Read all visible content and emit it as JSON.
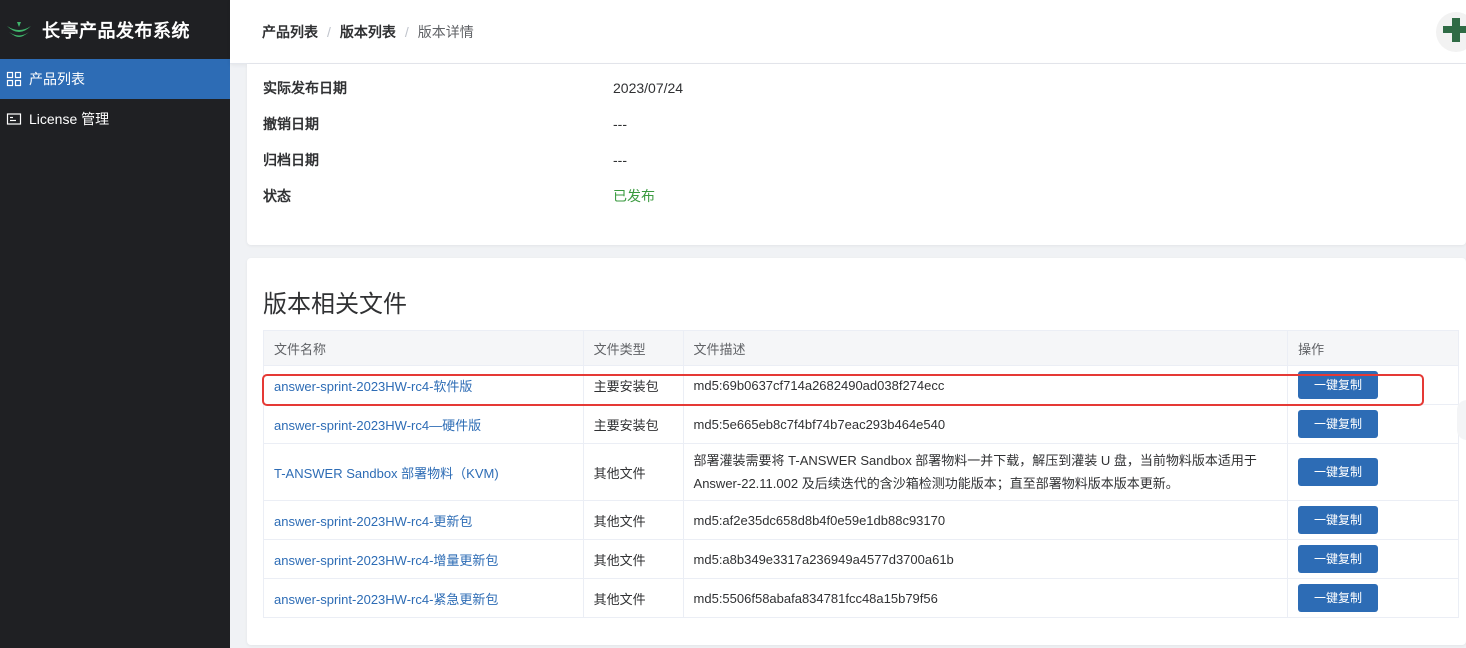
{
  "app": {
    "title": "长亭产品发布系统"
  },
  "sidebar": {
    "items": [
      {
        "label": "产品列表",
        "icon": "grid-icon",
        "active": true
      },
      {
        "label": "License 管理",
        "icon": "license-icon",
        "active": false
      }
    ]
  },
  "breadcrumb": {
    "items": [
      "产品列表",
      "版本列表",
      "版本详情"
    ],
    "separator": "/"
  },
  "info": {
    "rows": [
      {
        "label": "实际发布日期",
        "value": "2023/07/24"
      },
      {
        "label": "撤销日期",
        "value": "---"
      },
      {
        "label": "归档日期",
        "value": "---"
      },
      {
        "label": "状态",
        "value": "已发布"
      }
    ]
  },
  "files": {
    "title": "版本相关文件",
    "columns": [
      "文件名称",
      "文件类型",
      "文件描述",
      "操作"
    ],
    "rows": [
      {
        "name": "answer-sprint-2023HW-rc4-软件版",
        "type": "主要安装包",
        "desc": "md5:69b0637cf714a2682490ad038f274ecc",
        "action": "一键复制"
      },
      {
        "name": "answer-sprint-2023HW-rc4—硬件版",
        "type": "主要安装包",
        "desc": "md5:5e665eb8c7f4bf74b7eac293b464e540",
        "action": "一键复制"
      },
      {
        "name": "T-ANSWER Sandbox 部署物料（KVM)",
        "type": "其他文件",
        "desc": "部署灌装需要将 T-ANSWER Sandbox 部署物料一并下载，解压到灌装 U 盘，当前物料版本适用于 Answer-22.11.002 及后续迭代的含沙箱检测功能版本；直至部署物料版本版本更新。",
        "action": "一键复制"
      },
      {
        "name": "answer-sprint-2023HW-rc4-更新包",
        "type": "其他文件",
        "desc": "md5:af2e35dc658d8b4f0e59e1db88c93170",
        "action": "一键复制"
      },
      {
        "name": "answer-sprint-2023HW-rc4-增量更新包",
        "type": "其他文件",
        "desc": "md5:a8b349e3317a236949a4577d3700a61b",
        "action": "一键复制"
      },
      {
        "name": "answer-sprint-2023HW-rc4-紧急更新包",
        "type": "其他文件",
        "desc": "md5:5506f58abafa834781fcc48a15b79f56",
        "action": "一键复制"
      }
    ]
  },
  "colors": {
    "primary": "#2d6cb5",
    "sidebar": "#1f2023",
    "status_green": "#3a9a3f",
    "highlight": "#e53935"
  }
}
